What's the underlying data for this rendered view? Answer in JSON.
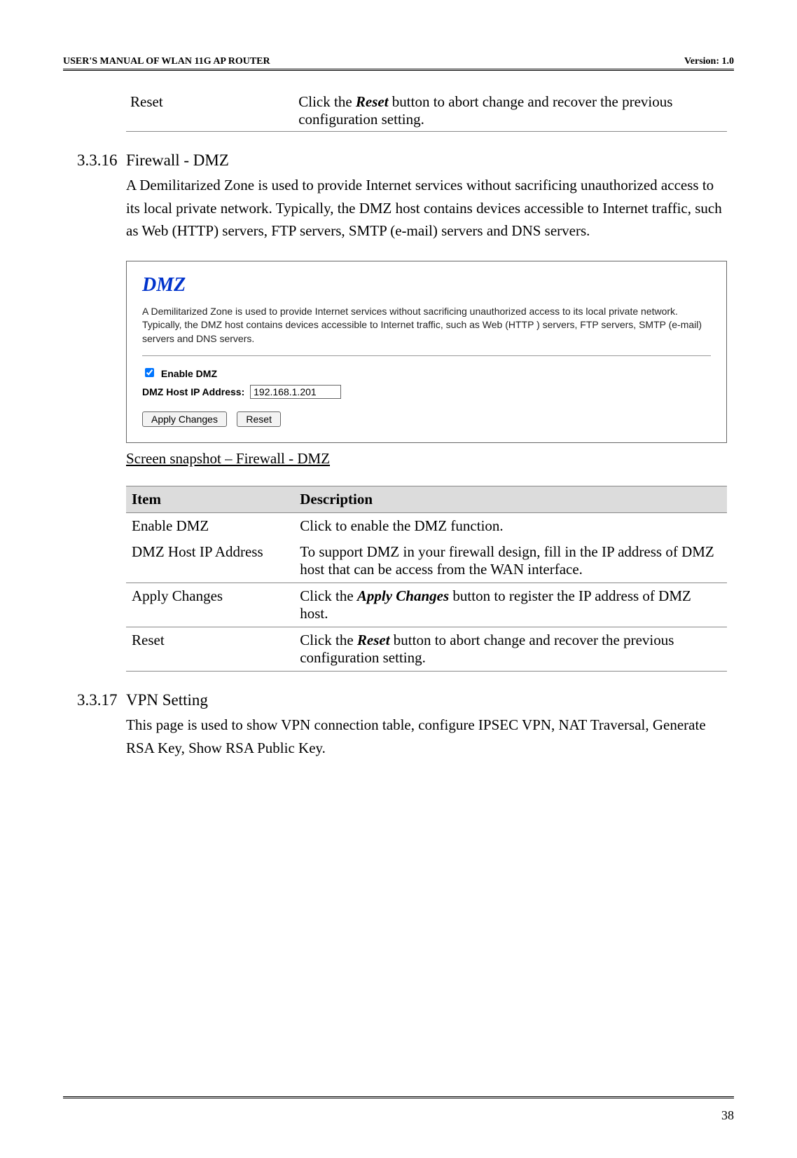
{
  "header": {
    "left": "USER'S MANUAL OF WLAN 11G AP ROUTER",
    "right": "Version: 1.0"
  },
  "top_table": {
    "col1": "Reset",
    "col2_a": "Click the ",
    "col2_b": "Reset",
    "col2_c": " button to abort change and recover the previous configuration setting."
  },
  "section1": {
    "num": "3.3.16",
    "title": "Firewall - DMZ",
    "body": "A Demilitarized Zone is used to provide Internet services without sacrificing unauthorized access to its local private network. Typically, the DMZ host contains devices accessible to Internet traffic, such as Web (HTTP) servers, FTP servers, SMTP (e-mail) servers and DNS servers."
  },
  "screenshot": {
    "title": "DMZ",
    "desc": "A Demilitarized Zone is used to provide Internet services without sacrificing unauthorized access to its local private network. Typically, the DMZ host contains devices accessible to Internet traffic, such as Web (HTTP ) servers, FTP servers, SMTP (e-mail) servers and DNS servers.",
    "enable_label": "Enable DMZ",
    "ip_label": "DMZ Host IP Address:",
    "ip_value": "192.168.1.201",
    "btn_apply": "Apply Changes",
    "btn_reset": "Reset"
  },
  "caption": "Screen snapshot – Firewall - DMZ",
  "desc_table": {
    "h1": "Item",
    "h2": "Description",
    "r1c1": "Enable DMZ",
    "r1c2": "Click to enable the DMZ function.",
    "r2c1": "DMZ Host IP Address",
    "r2c2": "To support DMZ in your firewall design, fill in the IP address of DMZ host that can be access from the WAN interface.",
    "r3c1": "Apply Changes",
    "r3c2a": "Click the ",
    "r3c2b": "Apply Changes",
    "r3c2c": " button to register the IP address of DMZ host.",
    "r4c1": "Reset",
    "r4c2a": "Click the ",
    "r4c2b": "Reset",
    "r4c2c": " button to abort change and recover the previous configuration setting."
  },
  "section2": {
    "num": "3.3.17",
    "title": "VPN Setting",
    "body": "This page is used to show VPN connection table, configure IPSEC VPN, NAT Traversal, Generate RSA Key, Show RSA Public Key."
  },
  "footer": {
    "page": "38"
  }
}
